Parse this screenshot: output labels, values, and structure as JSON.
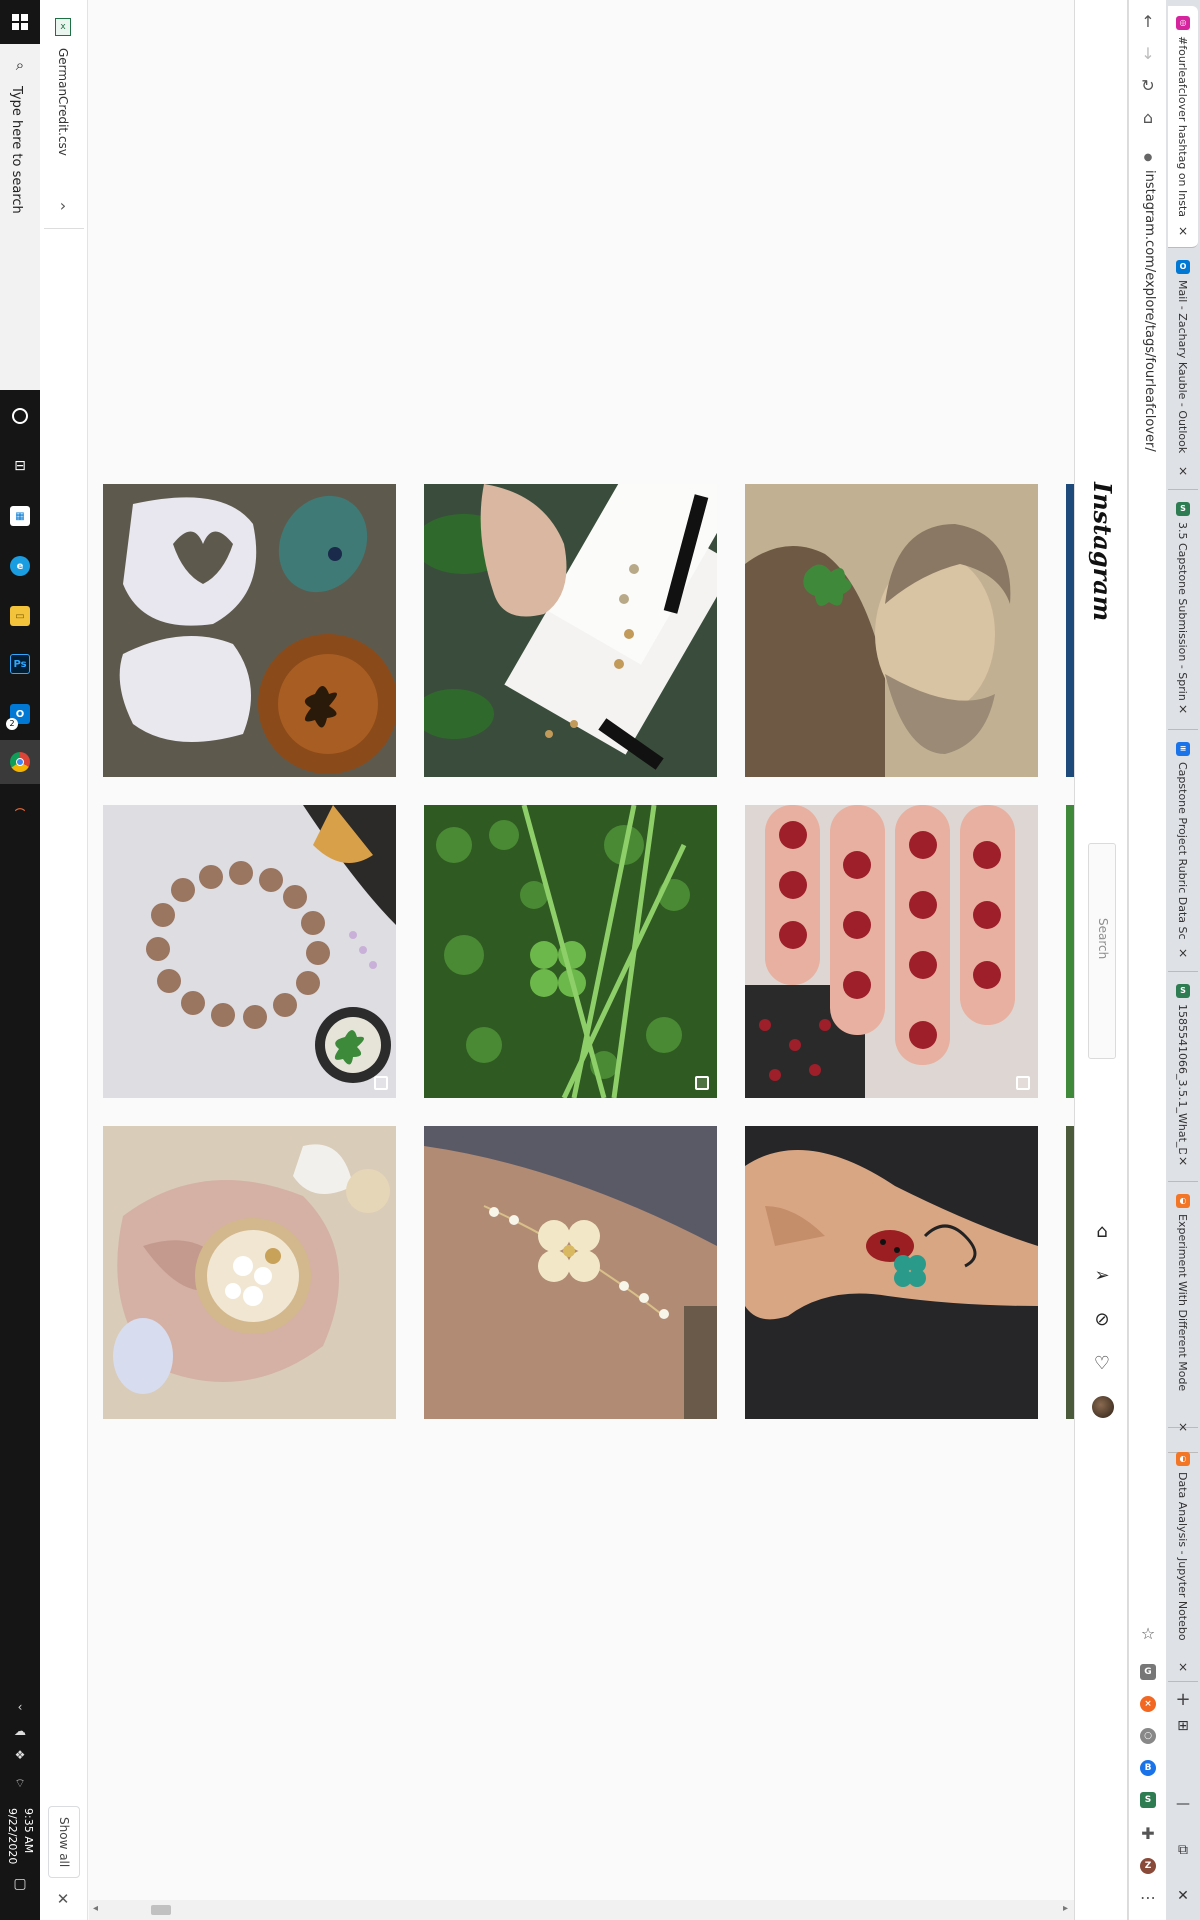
{
  "taskbar": {
    "search_placeholder": "Type here to search",
    "time": "9:35 AM",
    "date": "9/22/2020",
    "apps": [
      "cortana-icon",
      "task-view-icon",
      "store-icon",
      "edge-icon",
      "file-explorer-icon",
      "photoshop-icon",
      "outlook-icon",
      "chrome-icon",
      "matlab-icon"
    ],
    "outlook_badge": "2"
  },
  "downloads": {
    "file_name": "GermanCredit.csv",
    "show_all": "Show all"
  },
  "browser": {
    "url": "instagram.com/explore/tags/fourleafclover/",
    "tabs": [
      {
        "title": "#fourleafclover hashtag on Insta",
        "favicon": "instagram-icon",
        "color": "#d6249f"
      },
      {
        "title": "Mail - Zachary Kauble - Outlook",
        "favicon": "outlook-icon",
        "color": "#0078d4"
      },
      {
        "title": "3.5 Capstone Submission - Sprin",
        "favicon": "springboard-icon",
        "color": "#2e7d52"
      },
      {
        "title": "Capstone Project Rubric Data Sc",
        "favicon": "docs-icon",
        "color": "#1a73e8"
      },
      {
        "title": "1585541066_3.5.1_What_Data_to",
        "favicon": "springboard-icon",
        "color": "#2e7d52"
      },
      {
        "title": "Experiment With Different Mode",
        "favicon": "jupyter-icon",
        "color": "#f37626"
      },
      {
        "title": "Data Analysis - Jupyter Notebo",
        "favicon": "jupyter-icon",
        "color": "#f37626"
      }
    ]
  },
  "instagram": {
    "logo": "Instagram",
    "search_placeholder": "Search",
    "nav_icons": [
      "home-icon",
      "direct-icon",
      "explore-icon",
      "activity-icon",
      "profile-avatar"
    ],
    "posts": [
      {
        "subject": "ceramic clover dishes",
        "multi": false
      },
      {
        "subject": "clover stud earrings",
        "multi": false
      },
      {
        "subject": "vintage portrait with clover",
        "multi": false
      },
      {
        "subject": "stone bead bracelet with clover charm",
        "multi": true
      },
      {
        "subject": "four-leaf clover in grass",
        "multi": true
      },
      {
        "subject": "red clover rings on fingers",
        "multi": true
      },
      {
        "subject": "crystal dish on satin",
        "multi": false
      },
      {
        "subject": "clover chain bracelet",
        "multi": false
      },
      {
        "subject": "clover and ladybug hand tattoo",
        "multi": false
      }
    ]
  }
}
